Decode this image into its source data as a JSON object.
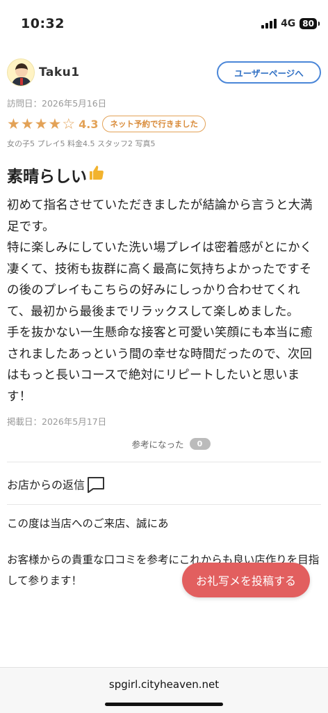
{
  "status": {
    "time": "10:32",
    "network": "4G",
    "battery": "80"
  },
  "review": {
    "username": "Taku1",
    "user_page_label": "ユーザーページへ",
    "visit_date": "訪問日：2026年5月16日",
    "stars_filled": 4,
    "stars_total": 5,
    "rating": "4.3",
    "booking_badge": "ネット予約で行きました",
    "sub_scores": "女の子5 プレイ5 料金4.5 スタッフ2 写真5",
    "title": "素晴らしい",
    "body": [
      "初めて指名させていただきましたが結論から言うと大満足です。",
      "特に楽しみにしていた洗い場プレイは密着感がとにかく凄くて、技術も抜群に高く最高に気持ちよかったですその後のプレイもこちらの好みにしっかり合わせてくれて、最初から最後までリラックスして楽しめました。",
      "手を抜かない一生懸命な接客と可愛い笑顔にも本当に癒されましたあっという間の幸せな時間だったので、次回はもっと長いコースで絶対にリピートしたいと思います！"
    ],
    "posted_date": "掲載日：2026年5月17日",
    "helpful_label": "参考になった",
    "helpful_count": "0"
  },
  "reply": {
    "title": "お店からの返信",
    "text1": "この度は当店へのご来店、誠にあ",
    "text2": "お客様からの貴重な口コミを参考にこれからも良い店作りを目指して参ります！"
  },
  "fab_label": "お礼写メを投稿する",
  "footer_domain": "spgirl.cityheaven.net",
  "colors": {
    "accent_orange": "#e3a257",
    "link_blue": "#4a86d8",
    "fab_red": "#e25f5f"
  }
}
